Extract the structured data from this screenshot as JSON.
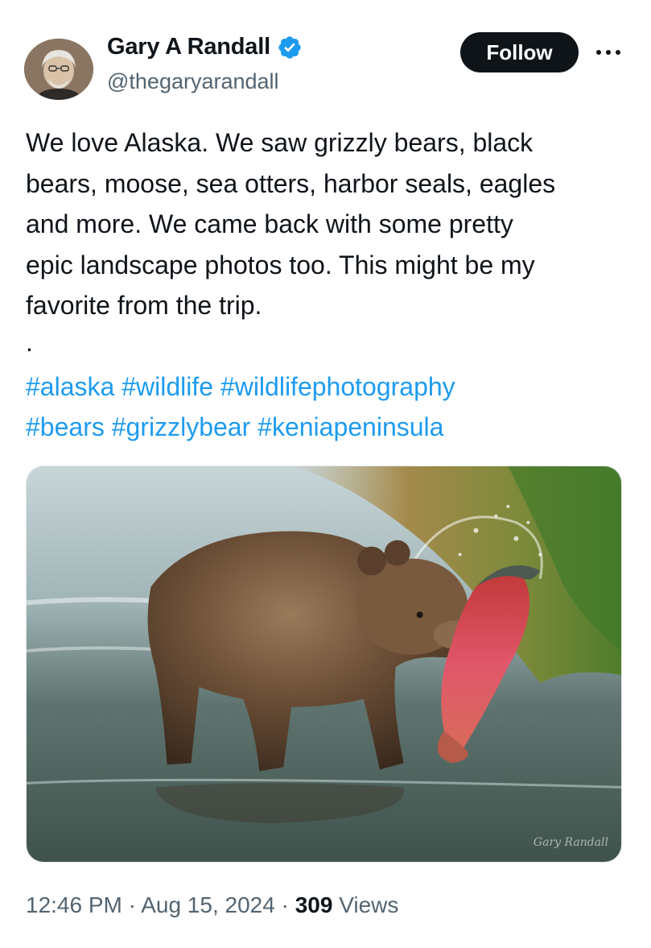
{
  "author": {
    "display_name": "Gary A Randall",
    "handle": "@thegaryarandall",
    "verified_icon": "verified-badge-icon",
    "verified_color": "#1d9bf0"
  },
  "actions": {
    "follow_label": "Follow",
    "more_icon": "more-horizontal-icon"
  },
  "tweet": {
    "lines": [
      "We love Alaska. We saw grizzly bears, black",
      "bears, moose, sea otters, harbor seals, eagles",
      "and more. We came back with some pretty",
      "epic landscape photos too. This might be my",
      "favorite from the trip."
    ],
    "dot": ".",
    "hashtags_line1": [
      "#alaska",
      "#wildlife",
      "#wildlifephotography"
    ],
    "hashtags_line2": [
      "#bears",
      "#grizzlybear",
      "#keniapeninsula"
    ],
    "hashtag_color": "#1d9bf0"
  },
  "media": {
    "watermark": "Gary Randall"
  },
  "meta": {
    "time": "12:46 PM",
    "separator": "·",
    "date": "Aug 15, 2024",
    "views_count": "309",
    "views_label": "Views"
  }
}
